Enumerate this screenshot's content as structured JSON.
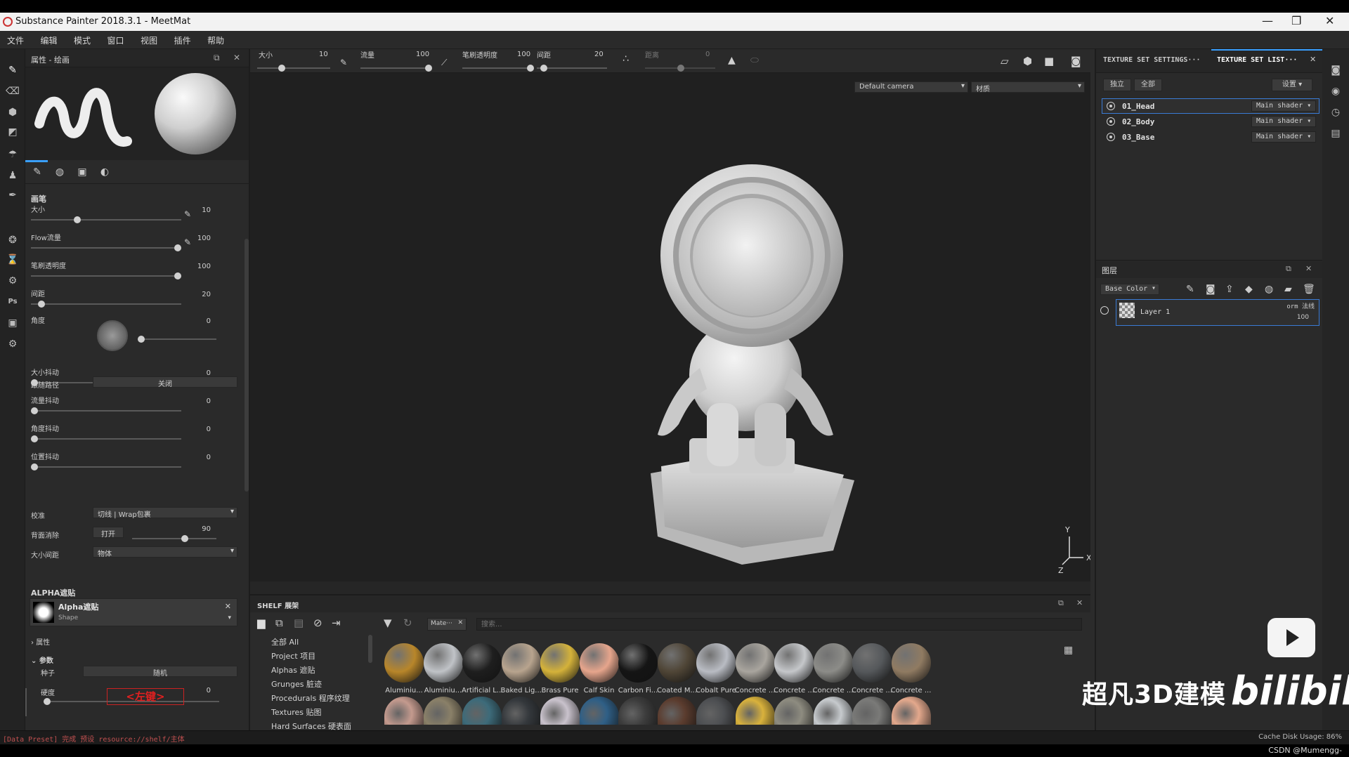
{
  "window": {
    "title": "Substance Painter 2018.3.1 - MeetMat"
  },
  "menu": [
    "文件",
    "编辑",
    "模式",
    "窗口",
    "视图",
    "插件",
    "帮助"
  ],
  "toolbar": {
    "size_label": "大小",
    "size_value": "10",
    "flow_label": "流量",
    "flow_value": "100",
    "opacity_label": "笔刷透明度",
    "opacity_value": "100",
    "spacing_label": "间距",
    "spacing_value": "20",
    "jitter_label": "距离",
    "jitter_value": "0",
    "camera": "Default camera",
    "material_mode": "材质"
  },
  "properties": {
    "title": "属性 - 绘画",
    "brush_section": "画笔",
    "params": [
      {
        "label": "大小",
        "value": "10",
        "level": 0.3
      },
      {
        "label": "Flow流量",
        "value": "100",
        "level": 1.0
      },
      {
        "label": "笔刷透明度",
        "value": "100",
        "level": 1.0
      },
      {
        "label": "间距",
        "value": "20",
        "level": 0.05
      },
      {
        "label": "角度",
        "value": "0",
        "level": 0.0
      },
      {
        "label": "大小抖动",
        "value": "0",
        "level": 0.0
      },
      {
        "label": "流量抖动",
        "value": "0",
        "level": 0.0
      },
      {
        "label": "角度抖动",
        "value": "0",
        "level": 0.0
      },
      {
        "label": "位置抖动",
        "value": "0",
        "level": 0.0
      }
    ],
    "follow_path_label": "跟随路径",
    "follow_path_value": "关闭",
    "alignment_label": "校准",
    "alignment_value": "切线 | Wrap包裹",
    "backface_label": "背面消除",
    "backface_value": "打开",
    "backface_angle": "90",
    "size_space_label": "大小间距",
    "size_space_value": "物体",
    "alpha_section": "ALPHA遮贴",
    "alpha_name": "Alpha遮贴",
    "alpha_type": "Shape",
    "attr_label": "属性",
    "params_label": "参数",
    "seed_label": "种子",
    "seed_value": "随机",
    "hardness_label": "硬度",
    "hardness_value": "0",
    "annotation": "<左键>"
  },
  "texture_sets": {
    "tab_settings": "TEXTURE SET SETTINGS···",
    "tab_list": "TEXTURE SET LIST···",
    "btn_solo": "独立",
    "btn_all": "全部",
    "btn_settings": "设置",
    "rows": [
      {
        "name": "01_Head",
        "shader": "Main shader"
      },
      {
        "name": "02_Body",
        "shader": "Main shader"
      },
      {
        "name": "03_Base",
        "shader": "Main shader"
      }
    ]
  },
  "layers": {
    "title": "图层",
    "channel": "Base Color",
    "layer_name": "Layer 1",
    "blend": "orm 法线",
    "opacity": "100"
  },
  "shelf": {
    "title": "SHELF 展架",
    "filter_tag": "Mate···",
    "search_placeholder": "搜索...",
    "categories": [
      "全部 All",
      "Project 项目",
      "Alphas 遮贴",
      "Grunges 脏迹",
      "Procedurals 程序纹理",
      "Textures 贴图",
      "Hard Surfaces 硬表面"
    ],
    "materials": [
      {
        "name": "Aluminiu...",
        "color": "#b8862a"
      },
      {
        "name": "Aluminiu...",
        "color": "#c0c3c7"
      },
      {
        "name": "Artificial L...",
        "color": "#1e1e1e"
      },
      {
        "name": "Baked Lig...",
        "color": "#b8a48e"
      },
      {
        "name": "Brass Pure",
        "color": "#d4b23a"
      },
      {
        "name": "Calf Skin",
        "color": "#e6a58c"
      },
      {
        "name": "Carbon Fi...",
        "color": "#151515"
      },
      {
        "name": "Coated M...",
        "color": "#4f4536"
      },
      {
        "name": "Cobalt Pure",
        "color": "#b9bcc3"
      },
      {
        "name": "Concrete ...",
        "color": "#a9a59e"
      },
      {
        "name": "Concrete ...",
        "color": "#c5c7ca"
      },
      {
        "name": "Concrete ...",
        "color": "#8c8c88"
      },
      {
        "name": "Concrete ...",
        "color": "#55585b"
      },
      {
        "name": "Concrete ...",
        "color": "#907b62"
      }
    ],
    "row2_colors": [
      "#c49a8e",
      "#8a8068",
      "#3d6b7a",
      "#34383c",
      "#c9c2cc",
      "#2f5f86",
      "#3c3c3c",
      "#5b3c2e",
      "#4d4f52",
      "#d9b23c",
      "#8e8c80",
      "#c6cacd",
      "#7a7a78",
      "#e3a88c"
    ]
  },
  "status": {
    "message": "[Data Preset] 完成 预设 resource://shelf/主体",
    "cache": "Cache Disk Usage:  86%"
  },
  "watermark": {
    "text": "超凡3D建模",
    "brand": "bilibili",
    "credit": "CSDN @Mumengg-"
  }
}
